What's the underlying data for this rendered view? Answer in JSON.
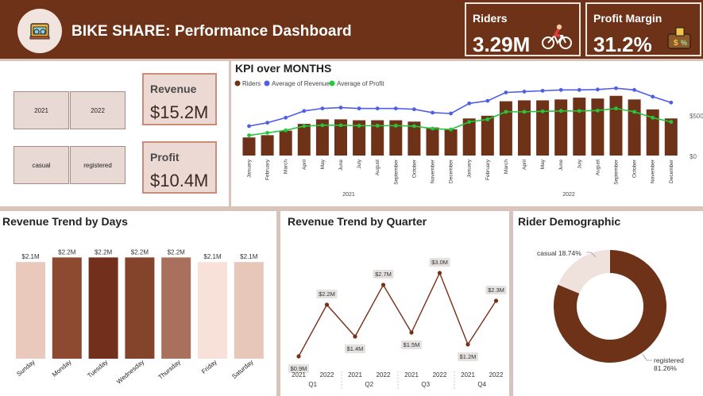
{
  "header": {
    "title": "BIKE SHARE: Performance Dashboard",
    "logo_icon": "bike-shop-icon",
    "riders_label": "Riders",
    "riders_value": "3.29M",
    "riders_icon": "cyclist-icon",
    "margin_label": "Profit Margin",
    "margin_value": "31.2%",
    "margin_icon": "money-bag-icon"
  },
  "slicers": {
    "year": [
      "2021",
      "2022"
    ],
    "rider_type": [
      "casual",
      "registered"
    ]
  },
  "cards": {
    "revenue_label": "Revenue",
    "revenue_value": "$15.2M",
    "profit_label": "Profit",
    "profit_value": "$10.4M"
  },
  "colors": {
    "brown": "#6e3218",
    "riders": "#6e3218",
    "revenue": "#4f5ee6",
    "profit": "#22c93c"
  },
  "kpi_chart": {
    "title": "KPI over MONTHS",
    "legend": [
      "Riders",
      "Average of Revenue",
      "Average of Profit"
    ],
    "y_ticks": [
      "$500",
      "$0"
    ],
    "years": [
      "2021",
      "2022"
    ]
  },
  "days_chart": {
    "title": "Revenue Trend by Days"
  },
  "quarter_chart": {
    "title": "Revenue Trend by Quarter"
  },
  "donut": {
    "title": "Rider Demographic",
    "casual_label": "casual 18.74%",
    "registered_label": "registered",
    "registered_pct": "81.26%"
  },
  "chart_data": [
    {
      "type": "bar",
      "title": "KPI over MONTHS",
      "categories": [
        "January",
        "February",
        "March",
        "April",
        "May",
        "June",
        "July",
        "August",
        "September",
        "October",
        "November",
        "December",
        "January",
        "February",
        "March",
        "April",
        "May",
        "June",
        "July",
        "August",
        "September",
        "October",
        "November",
        "December"
      ],
      "groups": [
        "2021",
        "2022"
      ],
      "series": [
        {
          "name": "Riders",
          "type": "bar",
          "values": [
            40,
            45,
            55,
            70,
            80,
            80,
            78,
            78,
            78,
            75,
            62,
            58,
            82,
            88,
            120,
            122,
            122,
            124,
            128,
            126,
            132,
            124,
            102,
            82
          ]
        },
        {
          "name": "Average of Revenue",
          "type": "line",
          "values": [
            350,
            390,
            450,
            530,
            560,
            570,
            560,
            560,
            560,
            550,
            510,
            500,
            620,
            650,
            750,
            760,
            770,
            780,
            780,
            785,
            800,
            780,
            700,
            630
          ]
        },
        {
          "name": "Average of Profit",
          "type": "line",
          "values": [
            240,
            270,
            300,
            350,
            360,
            360,
            355,
            355,
            355,
            350,
            320,
            310,
            400,
            430,
            520,
            520,
            525,
            530,
            530,
            535,
            560,
            520,
            450,
            400
          ]
        }
      ],
      "y_ticks": [
        "$500",
        "$0"
      ]
    },
    {
      "type": "bar",
      "title": "Revenue Trend by Days",
      "categories": [
        "Sunday",
        "Monday",
        "Tuesday",
        "Wednesday",
        "Thursday",
        "Friday",
        "Saturday"
      ],
      "values": [
        2.1,
        2.2,
        2.2,
        2.2,
        2.2,
        2.1,
        2.1
      ],
      "labels": [
        "$2.1M",
        "$2.2M",
        "$2.2M",
        "$2.2M",
        "$2.2M",
        "$2.1M",
        "$2.1M"
      ],
      "bar_colors": [
        "#e9c9bb",
        "#8e4a30",
        "#722f1b",
        "#84432b",
        "#a8705d",
        "#f8e1d8",
        "#e6c7b9"
      ]
    },
    {
      "type": "line",
      "title": "Revenue Trend by Quarter",
      "quarters": [
        "Q1",
        "Q2",
        "Q3",
        "Q4"
      ],
      "years": [
        "2021",
        "2022",
        "2021",
        "2022",
        "2021",
        "2022",
        "2021",
        "2022"
      ],
      "values": [
        0.9,
        2.2,
        1.4,
        2.7,
        1.5,
        3.0,
        1.2,
        2.3
      ],
      "labels": [
        "$0.9M",
        "$2.2M",
        "$1.4M",
        "$2.7M",
        "$1.5M",
        "$3.0M",
        "$1.2M",
        "$2.3M"
      ]
    },
    {
      "type": "pie",
      "title": "Rider Demographic",
      "categories": [
        "casual",
        "registered"
      ],
      "values": [
        18.74,
        81.26
      ]
    }
  ]
}
